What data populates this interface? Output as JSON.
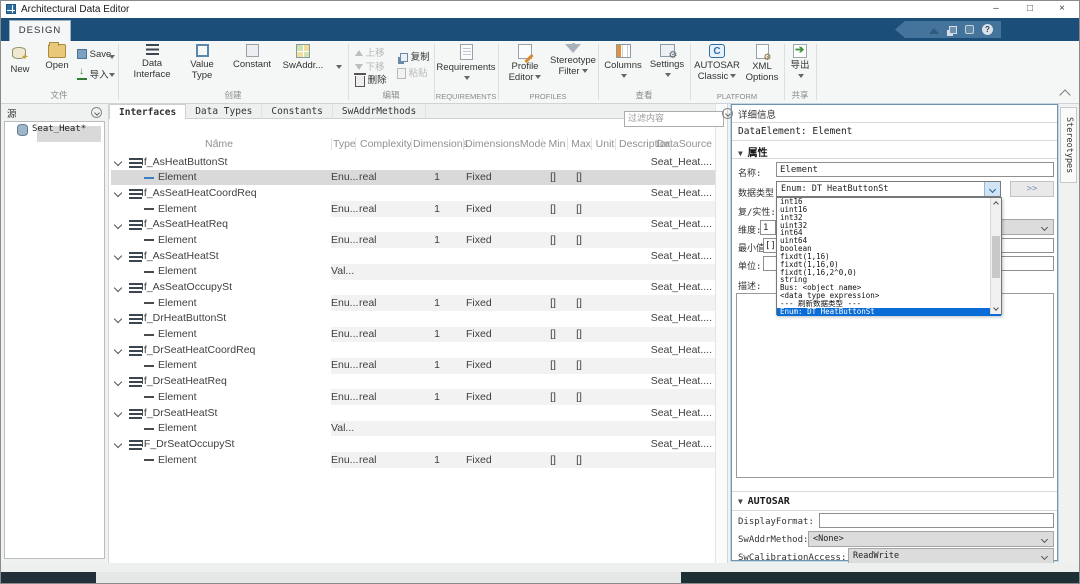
{
  "window": {
    "title": "Architectural Data Editor",
    "controls": {
      "minimize": "–",
      "maximize": "□",
      "close": "×"
    },
    "quick_access": {
      "help": "?"
    }
  },
  "ribbon": {
    "tab_label": "DESIGN",
    "groups": {
      "file": {
        "label": "文件",
        "new": "New",
        "open": "Open",
        "save": "Save",
        "import": "导入"
      },
      "create": {
        "label": "创建",
        "data_interface": [
          "Data",
          "Interface"
        ],
        "value_type": [
          "Value",
          "Type"
        ],
        "constant": "Constant",
        "swaddr": "SwAddr..."
      },
      "edit": {
        "label": "编辑",
        "up": "上移",
        "down": "下移",
        "delete": "删除",
        "copy": "复制",
        "paste": "粘贴"
      },
      "requirements": {
        "label": "REQUIREMENTS",
        "button": "Requirements"
      },
      "profiles": {
        "label": "PROFILES",
        "profile_editor": [
          "Profile",
          "Editor"
        ],
        "stereotype_filter": [
          "Stereotype",
          "Filter"
        ]
      },
      "view": {
        "label": "查看",
        "columns": "Columns",
        "settings": "Settings"
      },
      "platform": {
        "label": "PLATFORM",
        "autosar": [
          "AUTOSAR",
          "Classic"
        ],
        "xml": [
          "XML",
          "Options"
        ]
      },
      "share": {
        "label": "共享",
        "export": "导出"
      }
    }
  },
  "left_panel": {
    "header": "源",
    "tree_item": "Seat_Heat*"
  },
  "main": {
    "tabs": [
      {
        "label": "Interfaces",
        "active": true
      },
      {
        "label": "Data Types"
      },
      {
        "label": "Constants"
      },
      {
        "label": "SwAddrMethods"
      }
    ],
    "filter_placeholder": "过滤内容",
    "table": {
      "columns": [
        "Name",
        "Type",
        "Complexity",
        "Dimensions",
        "DimensionsMode",
        "Min",
        "Max",
        "Unit",
        "Description",
        "DataSource"
      ],
      "rows": [
        {
          "kind": "interface",
          "name": "If_AsHeatButtonSt",
          "dataSource": "Seat_Heat...."
        },
        {
          "kind": "element",
          "name": "Element",
          "type": "Enu...",
          "complexity": "real",
          "dimensions": "1",
          "dimensionsMode": "Fixed",
          "min": "[]",
          "max": "[]",
          "selected": true
        },
        {
          "kind": "interface",
          "name": "If_AsSeatHeatCoordReq",
          "dataSource": "Seat_Heat...."
        },
        {
          "kind": "element",
          "name": "Element",
          "type": "Enu...",
          "complexity": "real",
          "dimensions": "1",
          "dimensionsMode": "Fixed",
          "min": "[]",
          "max": "[]"
        },
        {
          "kind": "interface",
          "name": "If_AsSeatHeatReq",
          "dataSource": "Seat_Heat...."
        },
        {
          "kind": "element",
          "name": "Element",
          "type": "Enu...",
          "complexity": "real",
          "dimensions": "1",
          "dimensionsMode": "Fixed",
          "min": "[]",
          "max": "[]"
        },
        {
          "kind": "interface",
          "name": "If_AsSeatHeatSt",
          "dataSource": "Seat_Heat...."
        },
        {
          "kind": "element",
          "name": "Element",
          "type": "Val..."
        },
        {
          "kind": "interface",
          "name": "If_AsSeatOccupySt",
          "dataSource": "Seat_Heat...."
        },
        {
          "kind": "element",
          "name": "Element",
          "type": "Enu...",
          "complexity": "real",
          "dimensions": "1",
          "dimensionsMode": "Fixed",
          "min": "[]",
          "max": "[]"
        },
        {
          "kind": "interface",
          "name": "If_DrHeatButtonSt",
          "dataSource": "Seat_Heat...."
        },
        {
          "kind": "element",
          "name": "Element",
          "type": "Enu...",
          "complexity": "real",
          "dimensions": "1",
          "dimensionsMode": "Fixed",
          "min": "[]",
          "max": "[]"
        },
        {
          "kind": "interface",
          "name": "If_DrSeatHeatCoordReq",
          "dataSource": "Seat_Heat...."
        },
        {
          "kind": "element",
          "name": "Element",
          "type": "Enu...",
          "complexity": "real",
          "dimensions": "1",
          "dimensionsMode": "Fixed",
          "min": "[]",
          "max": "[]"
        },
        {
          "kind": "interface",
          "name": "If_DrSeatHeatReq",
          "dataSource": "Seat_Heat...."
        },
        {
          "kind": "element",
          "name": "Element",
          "type": "Enu...",
          "complexity": "real",
          "dimensions": "1",
          "dimensionsMode": "Fixed",
          "min": "[]",
          "max": "[]"
        },
        {
          "kind": "interface",
          "name": "If_DrSeatHeatSt",
          "dataSource": "Seat_Heat...."
        },
        {
          "kind": "element",
          "name": "Element",
          "type": "Val..."
        },
        {
          "kind": "interface",
          "name": "IF_DrSeatOccupySt",
          "dataSource": "Seat_Heat...."
        },
        {
          "kind": "element",
          "name": "Element",
          "type": "Enu...",
          "complexity": "real",
          "dimensions": "1",
          "dimensionsMode": "Fixed",
          "min": "[]",
          "max": "[]"
        }
      ]
    }
  },
  "details_panel": {
    "header": "详细信息",
    "object": "DataElement: Element",
    "properties_section": "属性",
    "autosar_section": "AUTOSAR",
    "fields": {
      "name_label": "名称:",
      "name_value": "Element",
      "datatype_label": "数据类型:",
      "datatype_value": "Enum: DT HeatButtonSt",
      "complexity_label": "复/实性:",
      "dimensions_label": "维度:",
      "dimensions_value": "1",
      "min_label": "最小值:",
      "min_value": "[]",
      "unit_label": "单位:",
      "description_label": "描述:",
      "more_button": ">>"
    },
    "dropdown": {
      "items": [
        {
          "label": "int16"
        },
        {
          "label": "uint16"
        },
        {
          "label": "int32"
        },
        {
          "label": "uint32"
        },
        {
          "label": "int64"
        },
        {
          "label": "uint64"
        },
        {
          "label": "boolean"
        },
        {
          "label": "fixdt(1,16)"
        },
        {
          "label": "fixdt(1,16,0)"
        },
        {
          "label": "fixdt(1,16,2^0,0)"
        },
        {
          "label": "string"
        },
        {
          "label": "Bus: <object name>"
        },
        {
          "label": "<data type expression>"
        },
        {
          "label": "--- 刷新数据类型 ---"
        },
        {
          "label": "Enum: DT HeatButtonSt",
          "selected": true
        }
      ]
    },
    "autosar_fields": {
      "display_format_label": "DisplayFormat:",
      "sw_addr_label": "SwAddrMethod:",
      "sw_addr_value": "<None>",
      "sw_cal_label": "SwCalibrationAccess:",
      "sw_cal_value": "ReadWrite"
    }
  },
  "right_tab": {
    "label": "Stereotypes"
  }
}
